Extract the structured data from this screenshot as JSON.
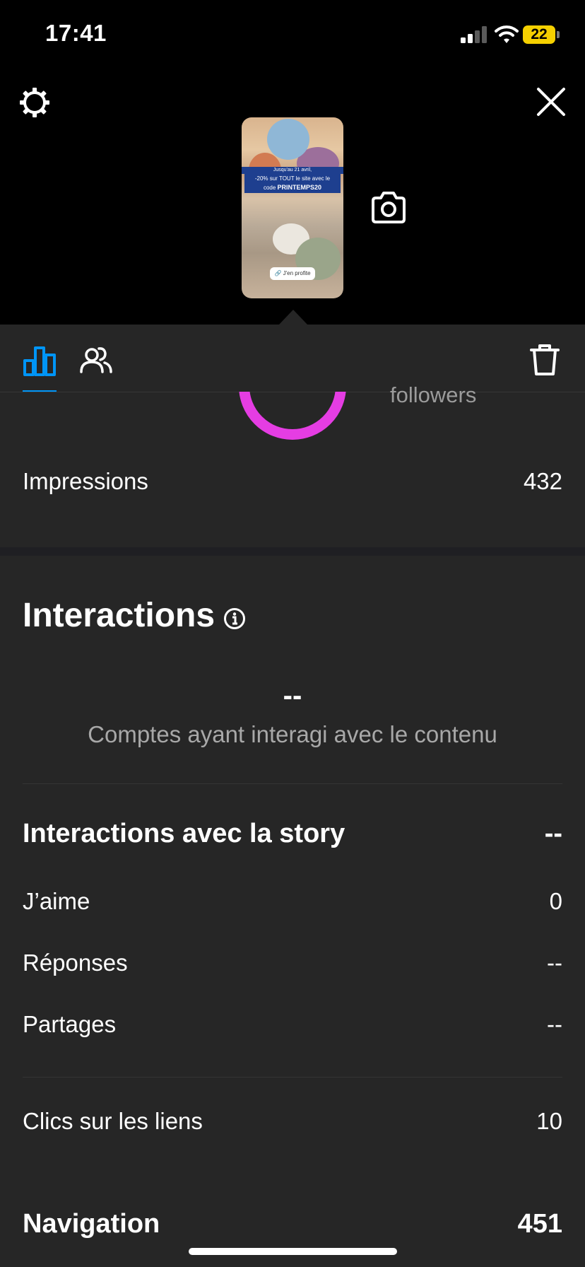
{
  "status_bar": {
    "time": "17:41",
    "battery": "22"
  },
  "preview": {
    "banner_top": "Jusqu'au 21 avril,",
    "banner_line1": "-20% sur TOUT le site avec le",
    "banner_line2_prefix": "code ",
    "banner_code": "PRINTEMPS20",
    "link_sticker": "J'en profite"
  },
  "overview": {
    "followers_label": "followers",
    "impressions_label": "Impressions",
    "impressions_value": "432"
  },
  "interactions": {
    "title": "Interactions",
    "accounts_value": "--",
    "accounts_label": "Comptes ayant interagi avec le contenu",
    "story_interactions_label": "Interactions avec la story",
    "story_interactions_value": "--",
    "likes_label": "J’aime",
    "likes_value": "0",
    "replies_label": "Réponses",
    "replies_value": "--",
    "shares_label": "Partages",
    "shares_value": "--",
    "link_clicks_label": "Clics sur les liens",
    "link_clicks_value": "10"
  },
  "navigation": {
    "label": "Navigation",
    "value": "451"
  },
  "colors": {
    "accent": "#0095f6",
    "ring": "#e53de3",
    "background": "#262626",
    "battery": "#f5d000"
  },
  "icons": [
    "gear-icon",
    "close-icon",
    "camera-icon",
    "bar-chart-icon",
    "people-icon",
    "trash-icon",
    "info-icon"
  ]
}
